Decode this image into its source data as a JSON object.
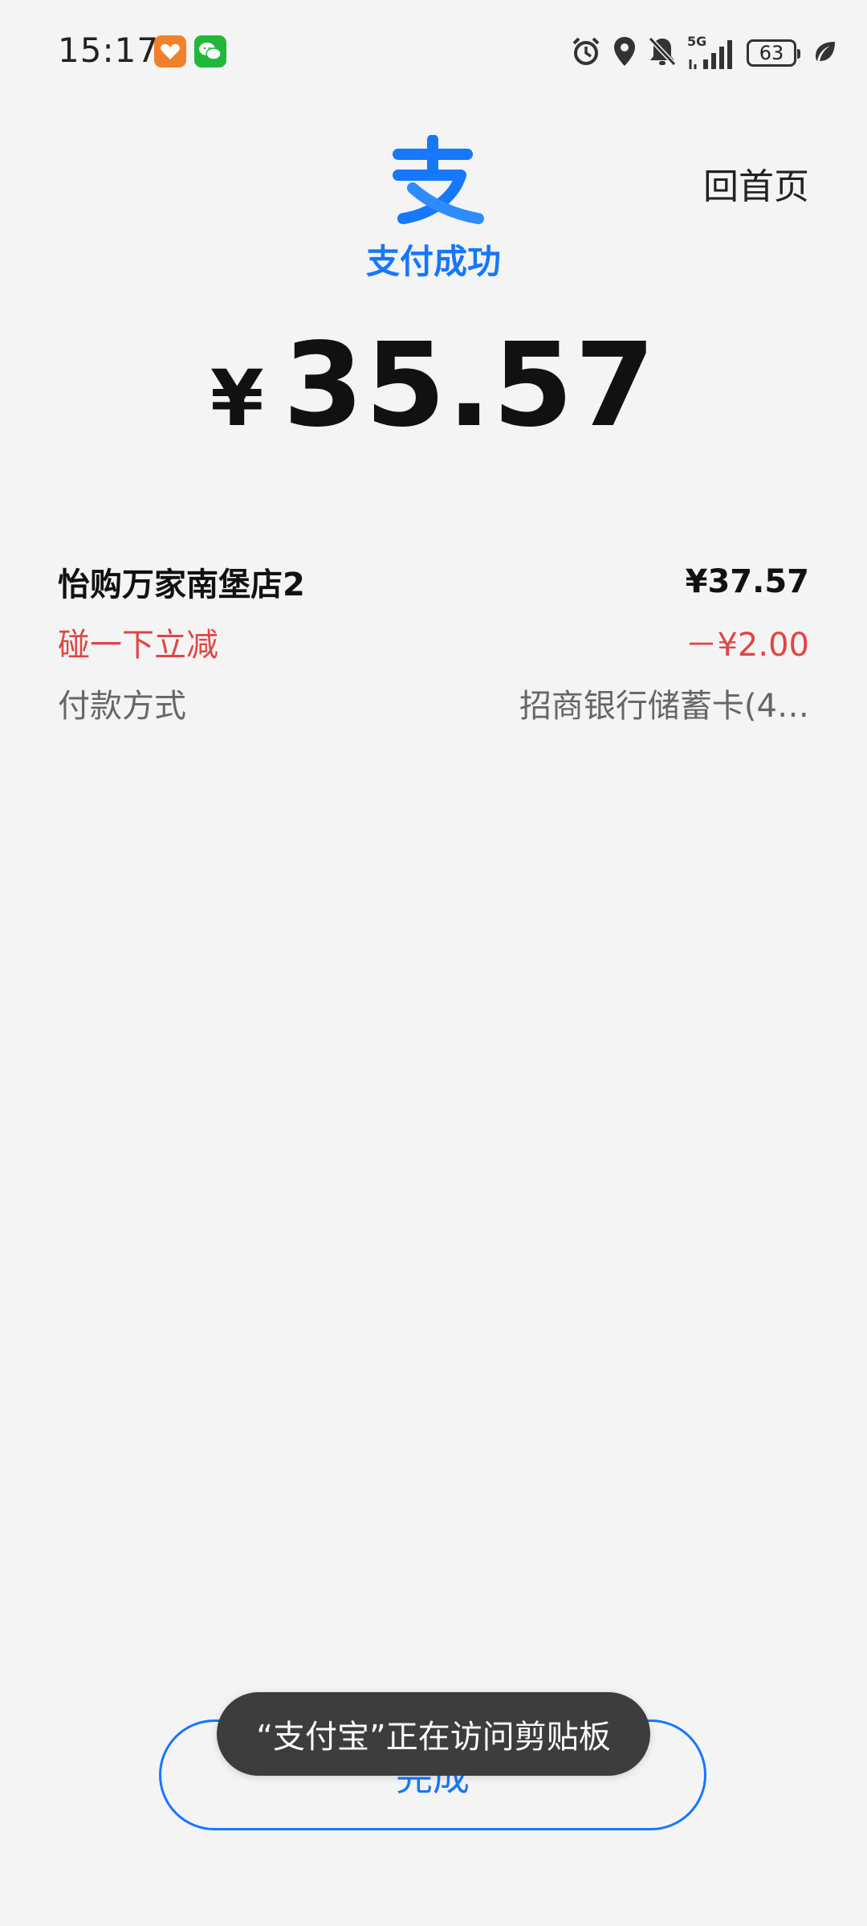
{
  "status_bar": {
    "time": "15:17",
    "network": "5G",
    "battery": "63"
  },
  "header": {
    "home_label": "回首页",
    "status_text": "支付成功",
    "brand_color": "#1677ff"
  },
  "payment": {
    "currency_symbol": "¥",
    "amount": "35.57"
  },
  "details": [
    {
      "label": "怡购万家南堡店2",
      "value": "¥37.57"
    },
    {
      "label": "碰一下立减",
      "value": "－¥2.00"
    },
    {
      "label": "付款方式",
      "value": "招商银行储蓄卡(4…"
    }
  ],
  "done_label": "完成",
  "toast": "“支付宝”正在访问剪贴板",
  "colors": {
    "discount": "#e04545",
    "background": "#f4f4f4"
  }
}
